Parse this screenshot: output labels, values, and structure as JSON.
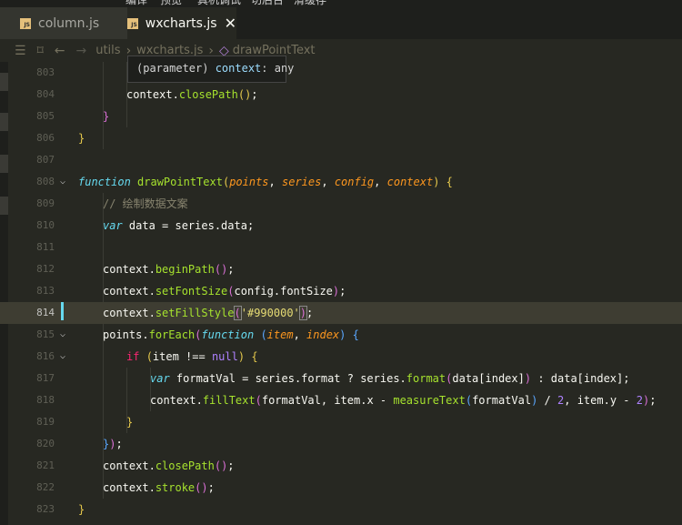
{
  "menubar": [
    "编译",
    "预览",
    "真机调试",
    "切后台",
    "清缓存"
  ],
  "tabs": [
    {
      "label": "column.js",
      "icon": "JS",
      "active": false
    },
    {
      "label": "wxcharts.js",
      "icon": "JS",
      "active": true
    }
  ],
  "breadcrumb": [
    "utils",
    "wxcharts.js",
    "drawPointText"
  ],
  "tooltip": {
    "prefix": "(parameter) ",
    "name": "context",
    "suffix": ": any"
  },
  "line_numbers": [
    "803",
    "804",
    "805",
    "806",
    "807",
    "808",
    "809",
    "810",
    "811",
    "812",
    "813",
    "814",
    "815",
    "816",
    "817",
    "818",
    "819",
    "820",
    "821",
    "822",
    "823"
  ],
  "code": {
    "l804_obj": "context",
    "l804_fn": "closePath",
    "l808_kw": "function",
    "l808_name": "drawPointText",
    "l808_p1": "points",
    "l808_p2": "series",
    "l808_p3": "config",
    "l808_p4": "context",
    "l809_comment": "// 绘制数据文案",
    "l810_kw": "var",
    "l810_rest": " data = series.data;",
    "l812_fn": "beginPath",
    "l813_fn": "setFontSize",
    "l813_arg": "config.fontSize",
    "l814_fn": "setFillStyle",
    "l814_str": "'#990000'",
    "l815_obj": "points",
    "l815_fn": "forEach",
    "l815_kw": "function",
    "l815_p1": "item",
    "l815_p2": "index",
    "l816_kw": "if",
    "l816_cond": "item !== ",
    "l816_null": "null",
    "l817_kw": "var",
    "l817_a": " formatVal = series.format ? series.",
    "l817_fn": "format",
    "l817_b": "data[index]",
    "l817_c": " : data[index];",
    "l818_fn": "fillText",
    "l818_a": "formatVal, item.x - ",
    "l818_fn2": "measureText",
    "l818_b": "formatVal",
    "l818_c": " / ",
    "l818_n1": "2",
    "l818_d": ", item.y - ",
    "l818_n2": "2",
    "l821_fn": "closePath",
    "l822_fn": "stroke",
    "obj": "context"
  }
}
